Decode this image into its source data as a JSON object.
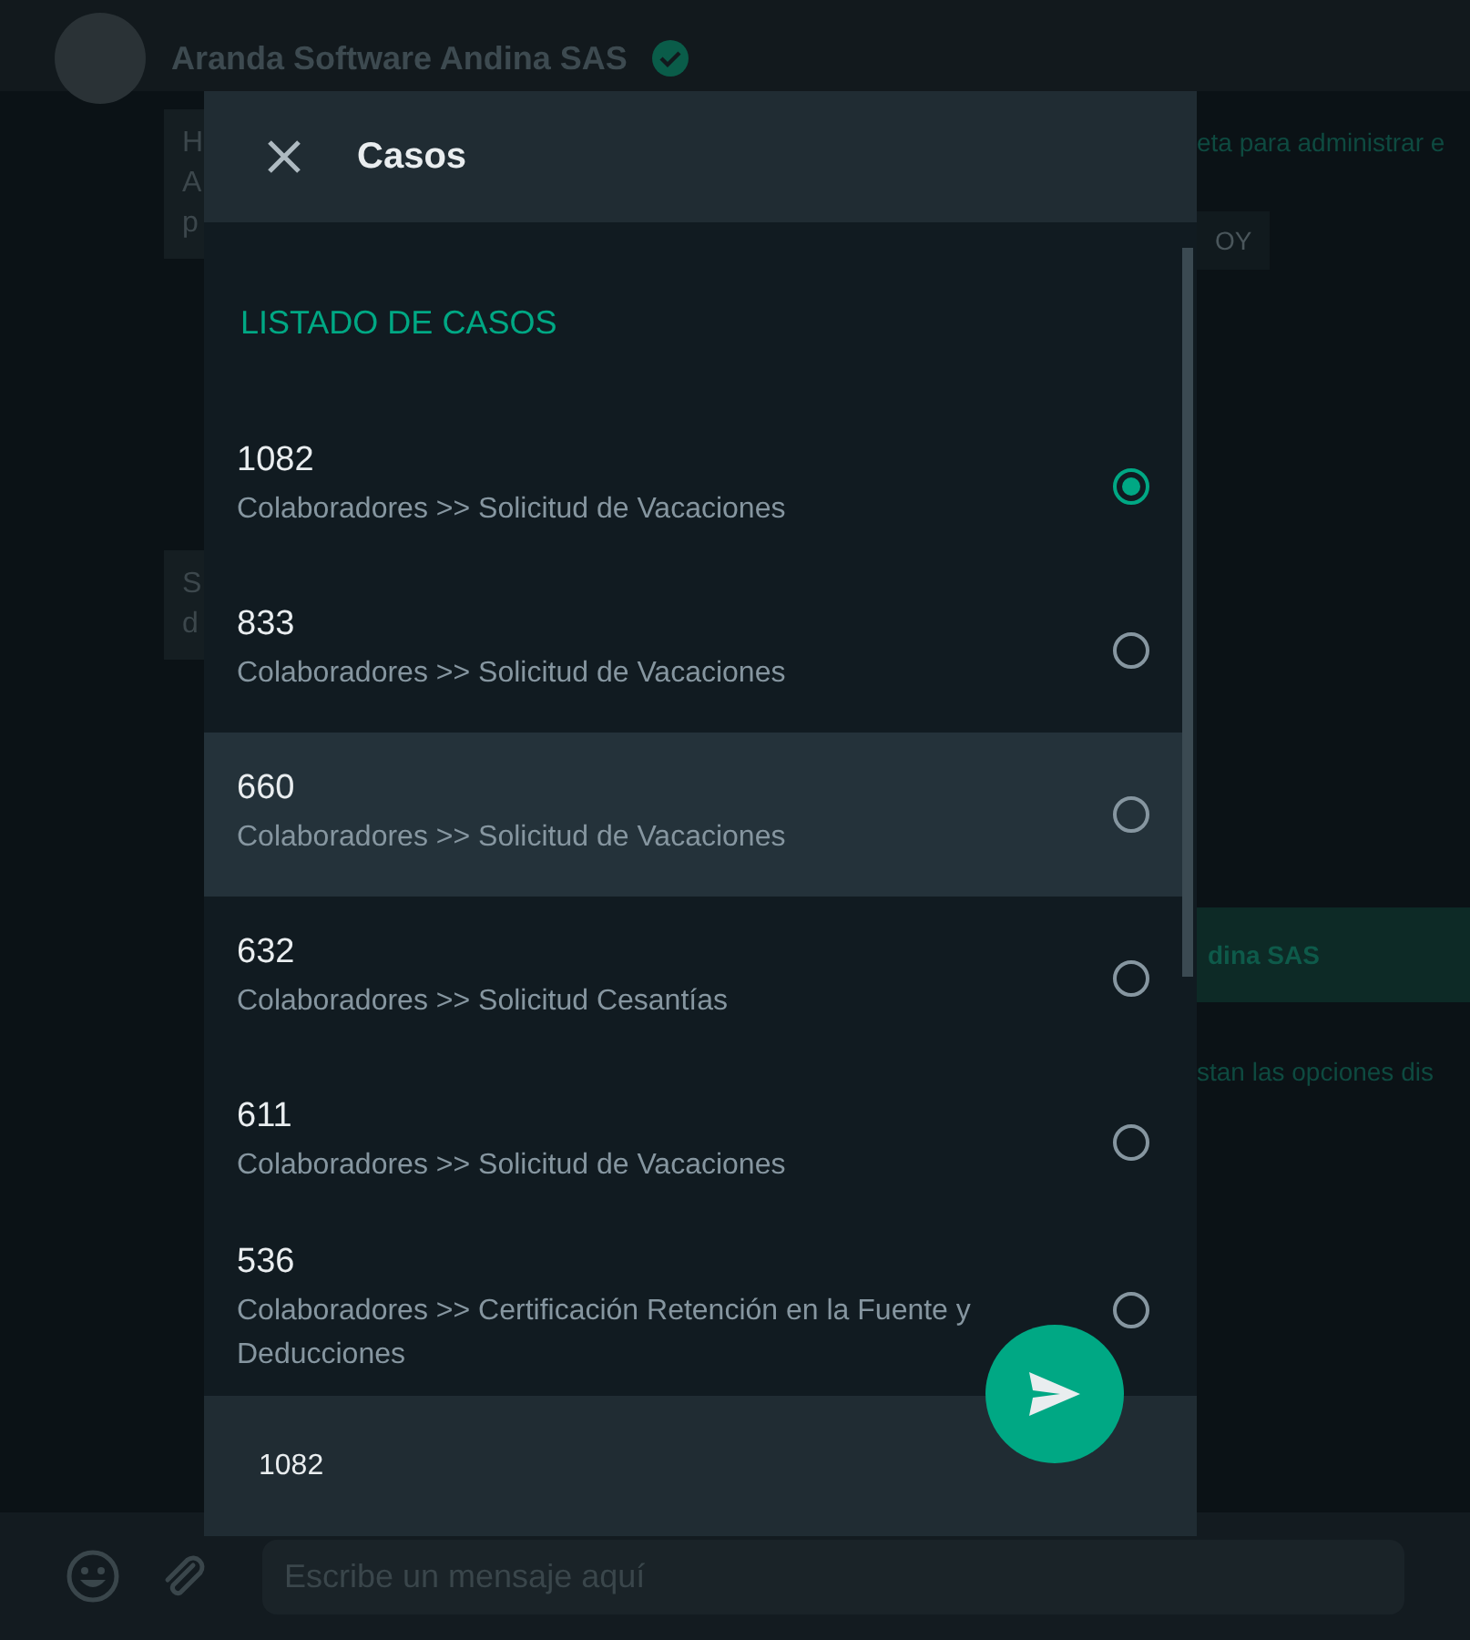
{
  "chat_header": {
    "title": "Aranda Software Andina SAS",
    "verified": true
  },
  "background_left": [
    {
      "lines": [
        "H",
        "A",
        "p"
      ]
    },
    {
      "lines": [
        "S",
        "d"
      ]
    }
  ],
  "background_right": [
    {
      "text": "eta para administrar e",
      "kind": "plain"
    },
    {
      "text": "OY",
      "kind": "chip"
    },
    {
      "text": "dina SAS",
      "kind": "sender"
    },
    {
      "text": "stan las opciones dis",
      "kind": "plain"
    }
  ],
  "dialog": {
    "title": "Casos",
    "section": "LISTADO DE CASOS",
    "items": [
      {
        "number": "1082",
        "path": "Colaboradores >> Solicitud de Vacaciones",
        "selected": true,
        "highlighted": false
      },
      {
        "number": "833",
        "path": "Colaboradores >> Solicitud de Vacaciones",
        "selected": false,
        "highlighted": false
      },
      {
        "number": "660",
        "path": "Colaboradores >> Solicitud de Vacaciones",
        "selected": false,
        "highlighted": true
      },
      {
        "number": "632",
        "path": "Colaboradores >> Solicitud Cesantías",
        "selected": false,
        "highlighted": false
      },
      {
        "number": "611",
        "path": "Colaboradores >> Solicitud de Vacaciones",
        "selected": false,
        "highlighted": false
      },
      {
        "number": "536",
        "path": "Colaboradores >> Certificación Retención en la Fuente y Deducciones",
        "selected": false,
        "highlighted": false
      }
    ],
    "footer_value": "1082"
  },
  "composer": {
    "placeholder": "Escribe un mensaje aquí"
  }
}
